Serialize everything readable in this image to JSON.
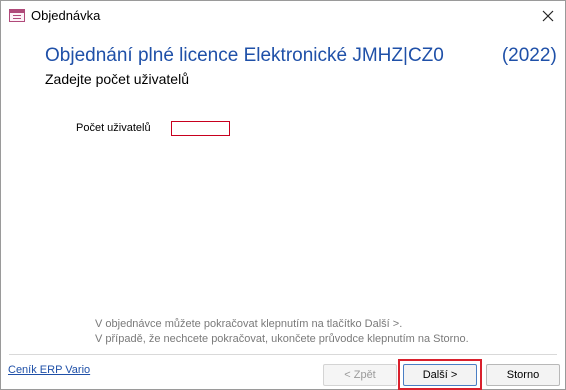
{
  "window": {
    "title": "Objednávka",
    "icon": "form-icon",
    "close_icon": "close-icon"
  },
  "header": {
    "title_prefix": "Objednání plné licence Elektronické JMHZ|CZ0",
    "title_suffix": "(2022)",
    "subtitle": "Zadejte počet uživatelů"
  },
  "form": {
    "users_label": "Počet uživatelů",
    "users_value": ""
  },
  "info": {
    "line1": "V objednávce můžete pokračovat klepnutím na tlačítko Další >.",
    "line2": "V případě, že nechcete pokračovat, ukončete průvodce klepnutím na Storno."
  },
  "footer": {
    "link_label": "Ceník ERP Vario",
    "back_label": "< Zpět",
    "next_label": "Další >",
    "cancel_label": "Storno"
  },
  "colors": {
    "heading": "#1f50a8",
    "highlight": "#d9202c",
    "input_border": "#c8001e"
  }
}
